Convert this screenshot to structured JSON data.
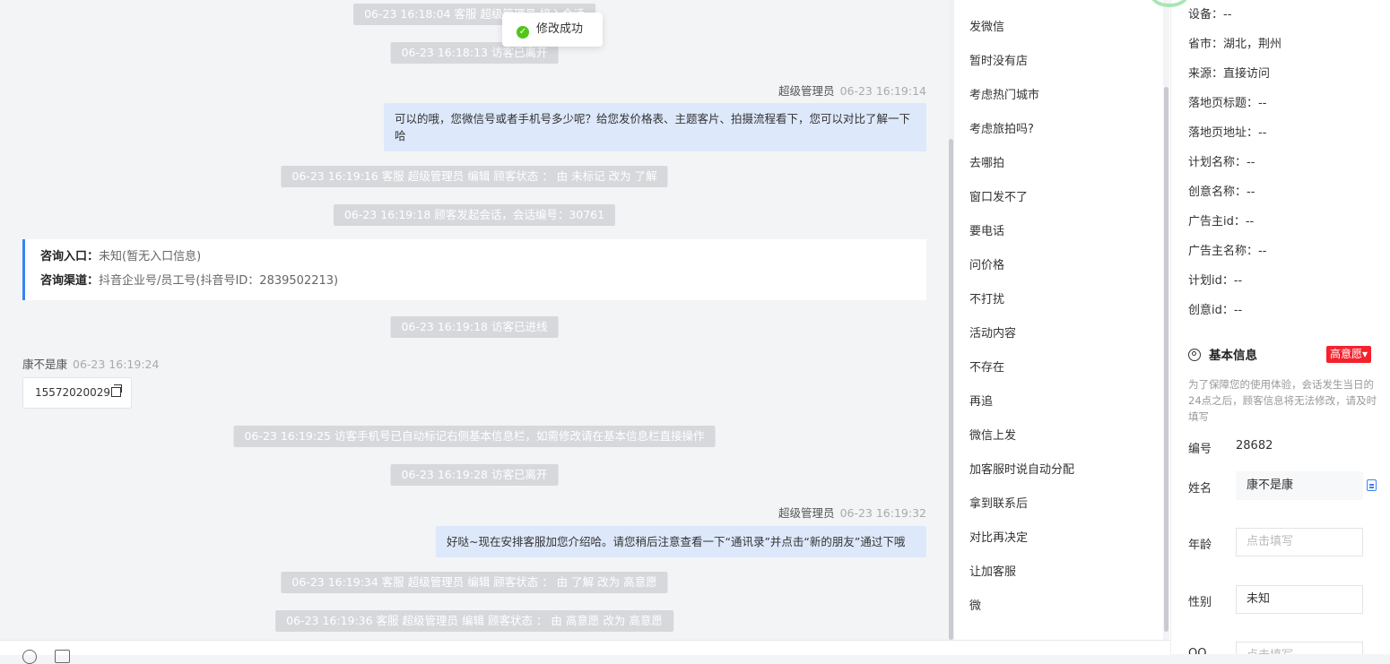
{
  "toast": {
    "text": "修改成功"
  },
  "chat": {
    "messages": [
      {
        "kind": "system",
        "text": "06-23 16:18:04 客服 超级管理员 接入会话"
      },
      {
        "kind": "system",
        "text": "06-23 16:18:13 访客已离开"
      },
      {
        "kind": "agent",
        "name": "超级管理员",
        "time": "06-23 16:19:14",
        "text": "可以的哦，您微信号或者手机号多少呢？给您发价格表、主题客片、拍摄流程看下，您可以对比了解一下哈"
      },
      {
        "kind": "system",
        "text": "06-23 16:19:16 客服 超级管理员 编辑 顾客状态 ： 由 未标记 改为 了解"
      },
      {
        "kind": "system",
        "text": "06-23 16:19:18 顾客发起会话，会话编号：30761"
      },
      {
        "kind": "system",
        "text": "06-23 16:19:18 访客已进线"
      },
      {
        "kind": "visitor",
        "name": "康不是康",
        "time": "06-23 16:19:24",
        "text": "15572020029"
      },
      {
        "kind": "system",
        "text": "06-23 16:19:25 访客手机号已自动标记右侧基本信息栏，如需修改请在基本信息栏直接操作"
      },
      {
        "kind": "system",
        "text": "06-23 16:19:28 访客已离开"
      },
      {
        "kind": "agent",
        "name": "超级管理员",
        "time": "06-23 16:19:32",
        "text": "好哒~现在安排客服加您介绍哈。请您稍后注意查看一下“通讯录”并点击“新的朋友”通过下哦"
      },
      {
        "kind": "system",
        "text": "06-23 16:19:34 客服 超级管理员 编辑 顾客状态 ： 由 了解 改为 高意愿"
      },
      {
        "kind": "system",
        "text": "06-23 16:19:36 客服 超级管理员 编辑 顾客状态 ： 由 高意愿 改为 高意愿"
      }
    ],
    "consult_card": {
      "entry_label": "咨询入口：",
      "entry_value": "未知(暂无入口信息)",
      "channel_label": "咨询渠道：",
      "channel_value": "抖音企业号/员工号(抖音号ID：2839502213)"
    }
  },
  "quick_replies": [
    "发微信",
    "暂时没有店",
    "考虑热门城市",
    "考虑旅拍吗?",
    "去哪拍",
    "窗口发不了",
    "要电话",
    "问价格",
    "不打扰",
    "活动内容",
    "不存在",
    "再追",
    "微信上发",
    "加客服时说自动分配",
    "拿到联系后",
    "对比再决定",
    "让加客服",
    "微"
  ],
  "panel": {
    "attributes": [
      "设备：--",
      "省市：湖北，荆州",
      "来源：直接访问",
      "落地页标题：--",
      "落地页地址：--",
      "计划名称：--",
      "创意名称：--",
      "广告主id：--",
      "广告主名称：--",
      "计划id：--",
      "创意id：--"
    ],
    "section_title": "基本信息",
    "intent_badge": "高意愿",
    "intent_caret": "▾",
    "tip": "为了保障您的使用体验，会话发生当日的24点之后，顾客信息将无法修改，请及时填写",
    "fields": {
      "id_label": "编号",
      "id_value": "28682",
      "name_label": "姓名",
      "name_value": "康不是康",
      "age_label": "年龄",
      "age_placeholder": "点击填写",
      "gender_label": "性别",
      "gender_value": "未知",
      "qq_label": "QQ",
      "qq_placeholder": "点击填写"
    }
  }
}
